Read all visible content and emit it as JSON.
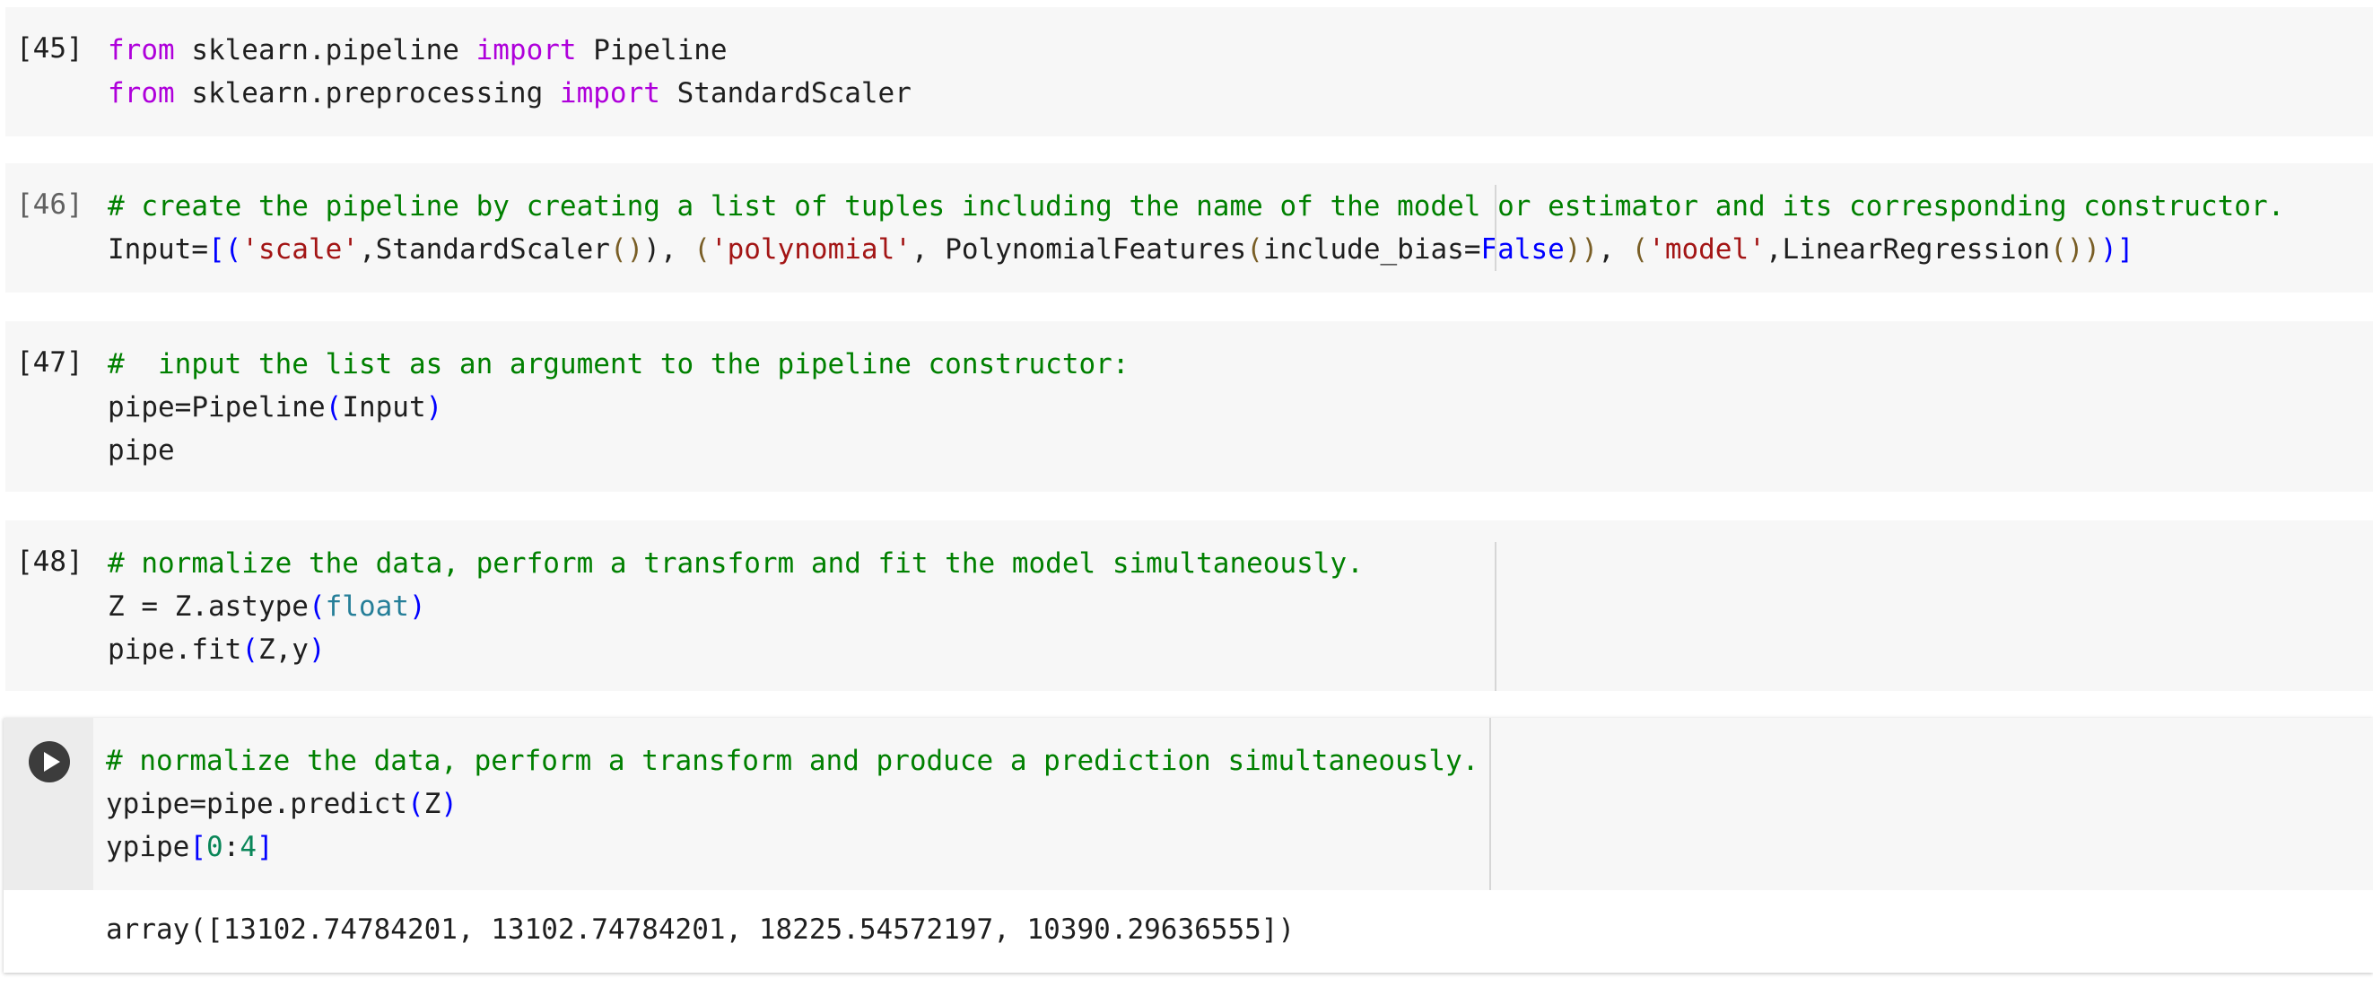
{
  "cells": [
    {
      "prompt": "[45]",
      "lines": [
        [
          [
            "kw",
            "from"
          ],
          [
            "df",
            " sklearn.pipeline "
          ],
          [
            "kw",
            "import"
          ],
          [
            "df",
            " Pipeline"
          ]
        ],
        [
          [
            "kw",
            "from"
          ],
          [
            "df",
            " sklearn.preprocessing "
          ],
          [
            "kw",
            "import"
          ],
          [
            "df",
            " StandardScaler"
          ]
        ]
      ]
    },
    {
      "prompt": "[46]",
      "lines": [
        [
          [
            "cm",
            "# create the pipeline by creating a list of tuples including the name of the model or estimator and its corresponding constructor."
          ]
        ],
        [
          [
            "df",
            "Input="
          ],
          [
            "bl",
            "[("
          ],
          [
            "st",
            "'scale'"
          ],
          [
            "df",
            ",StandardScaler"
          ],
          [
            "br",
            "()"
          ],
          [
            "df",
            "), "
          ],
          [
            "br",
            "("
          ],
          [
            "st",
            "'polynomial'"
          ],
          [
            "df",
            ", PolynomialFeatures"
          ],
          [
            "br",
            "("
          ],
          [
            "df",
            "include_bias="
          ],
          [
            "bl",
            "False"
          ],
          [
            "br",
            "))"
          ],
          [
            "df",
            ", "
          ],
          [
            "br",
            "("
          ],
          [
            "st",
            "'model'"
          ],
          [
            "df",
            ",LinearRegression"
          ],
          [
            "br",
            "())"
          ],
          [
            "bl",
            ")]"
          ]
        ]
      ]
    },
    {
      "prompt": "[47]",
      "lines": [
        [
          [
            "cm",
            "#  input the list as an argument to the pipeline constructor:"
          ]
        ],
        [
          [
            "df",
            "pipe=Pipeline"
          ],
          [
            "bl",
            "("
          ],
          [
            "df",
            "Input"
          ],
          [
            "bl",
            ")"
          ]
        ],
        [
          [
            "df",
            "pipe"
          ]
        ]
      ]
    },
    {
      "prompt": "[48]",
      "lines": [
        [
          [
            "cm",
            "# normalize the data, perform a transform and fit the model simultaneously."
          ]
        ],
        [
          [
            "df",
            "Z = Z.astype"
          ],
          [
            "bl",
            "("
          ],
          [
            "ty",
            "float"
          ],
          [
            "bl",
            ")"
          ]
        ],
        [
          [
            "df",
            "pipe.fit"
          ],
          [
            "bl",
            "("
          ],
          [
            "df",
            "Z,y"
          ],
          [
            "bl",
            ")"
          ]
        ]
      ]
    }
  ],
  "active_cell": {
    "run_icon": "play-icon",
    "lines": [
      [
        [
          "cm",
          "# normalize the data, perform a transform and produce a prediction simultaneously."
        ]
      ],
      [
        [
          "df",
          "ypipe=pipe.predict"
        ],
        [
          "bl",
          "("
        ],
        [
          "df",
          "Z"
        ],
        [
          "bl",
          ")"
        ]
      ],
      [
        [
          "df",
          "ypipe"
        ],
        [
          "bl",
          "["
        ],
        [
          "nm",
          "0"
        ],
        [
          "df",
          ":"
        ],
        [
          "nm",
          "4"
        ],
        [
          "bl",
          "]"
        ]
      ]
    ],
    "output": "array([13102.74784201, 13102.74784201, 18225.54572197, 10390.29636555])"
  }
}
